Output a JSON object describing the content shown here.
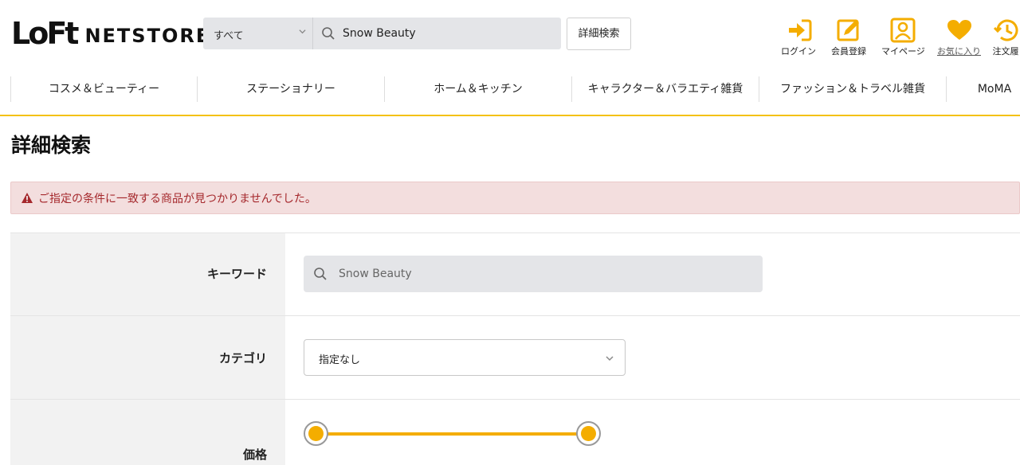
{
  "header": {
    "logo_mark": "LoFt",
    "logo_text": "NETSTORE",
    "search": {
      "scope": "すべて",
      "query": "Snow Beauty"
    },
    "advanced_search_label": "詳細検索",
    "utility": [
      {
        "label": "ログイン",
        "icon": "login-icon"
      },
      {
        "label": "会員登録",
        "icon": "register-icon"
      },
      {
        "label": "マイページ",
        "icon": "mypage-icon"
      },
      {
        "label": "お気に入り",
        "icon": "heart-icon"
      },
      {
        "label": "注文履",
        "icon": "history-icon"
      }
    ],
    "accent_color": "#f4ad00"
  },
  "nav": {
    "items": [
      "コスメ＆ビューティー",
      "ステーショナリー",
      "ホーム＆キッチン",
      "キャラクター＆バラエティ雑貨",
      "ファッション＆トラベル雑貨",
      "MoMA"
    ]
  },
  "page": {
    "title": "詳細検索",
    "alert": "ご指定の条件に一致する商品が見つかりませんでした。"
  },
  "form": {
    "keyword_label": "キーワード",
    "keyword_value": "Snow Beauty",
    "category_label": "カテゴリ",
    "category_value": "指定なし",
    "price_label": "価格",
    "price_range": {
      "min_fraction": 0.0,
      "max_fraction": 1.0
    }
  }
}
